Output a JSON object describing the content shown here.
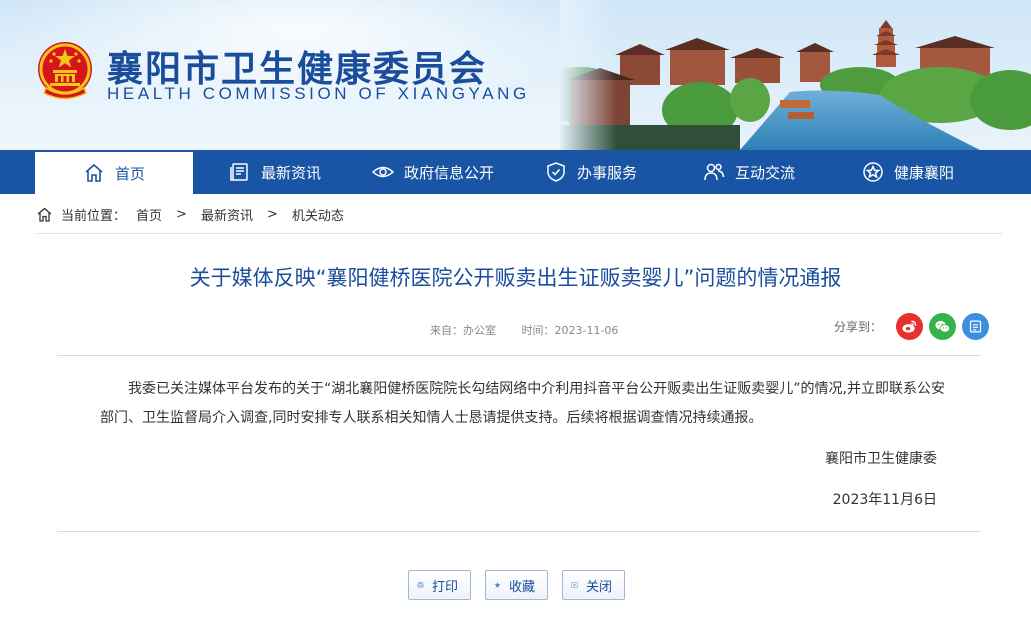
{
  "header": {
    "title": "襄阳市卫生健康委员会",
    "subtitle": "HEALTH COMMISSION OF XIANGYANG"
  },
  "nav": {
    "items": [
      {
        "label": "首页",
        "icon": "home-icon"
      },
      {
        "label": "最新资讯",
        "icon": "news-icon"
      },
      {
        "label": "政府信息公开",
        "icon": "eye-icon"
      },
      {
        "label": "办事服务",
        "icon": "shield-icon"
      },
      {
        "label": "互动交流",
        "icon": "people-icon"
      },
      {
        "label": "健康襄阳",
        "icon": "star-icon"
      }
    ]
  },
  "breadcrumb": {
    "prefix": "当前位置：",
    "items": [
      "首页",
      "最新资讯",
      "机关动态"
    ],
    "separator": ">"
  },
  "article": {
    "title": "关于媒体反映“襄阳健桥医院公开贩卖出生证贩卖婴儿”问题的情况通报",
    "source": "来自：办公室",
    "time": "时间：2023-11-06",
    "share_label": "分享到：",
    "body": "我委已关注媒体平台发布的关于“湖北襄阳健桥医院院长勾结网络中介利用抖音平台公开贩卖出生证贩卖婴儿”的情况,并立即联系公安部门、卫生监督局介入调查,同时安排专人联系相关知情人士恳请提供支持。后续将根据调查情况持续通报。",
    "signature_org": "襄阳市卫生健康委",
    "signature_date": "2023年11月6日"
  },
  "actions": {
    "print": "打印",
    "favorite": "收藏",
    "close": "关闭"
  },
  "colors": {
    "brand_blue": "#1a55a5",
    "title_blue": "#1a4e9c",
    "weibo_red": "#e6312f",
    "wechat_green": "#35b34a",
    "share_blue": "#3b8fde"
  }
}
